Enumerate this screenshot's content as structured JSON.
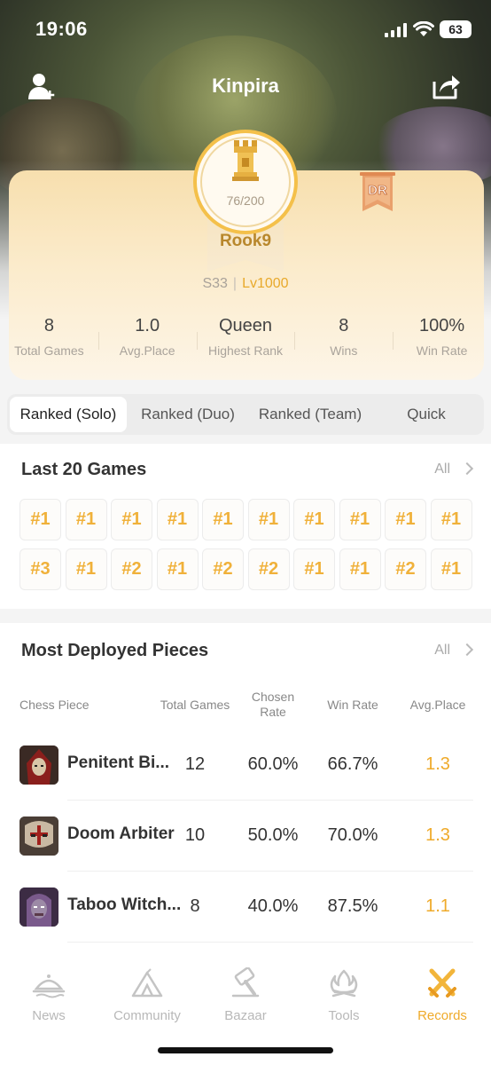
{
  "status_bar": {
    "time": "19:06",
    "battery": "63"
  },
  "header": {
    "title": "Kinpira"
  },
  "profile": {
    "rank_progress": "76/200",
    "rank_name": "Rook9",
    "season": "S33",
    "level": "Lv1000",
    "badge": "DR"
  },
  "stats": [
    {
      "value": "8",
      "label": "Total Games"
    },
    {
      "value": "1.0",
      "label": "Avg.Place"
    },
    {
      "value": "Queen",
      "label": "Highest Rank"
    },
    {
      "value": "8",
      "label": "Wins"
    },
    {
      "value": "100%",
      "label": "Win Rate"
    }
  ],
  "tabs": [
    "Ranked (Solo)",
    "Ranked (Duo)",
    "Ranked (Team)",
    "Quick"
  ],
  "last_games": {
    "title": "Last 20 Games",
    "all": "All",
    "results": [
      "#1",
      "#1",
      "#1",
      "#1",
      "#1",
      "#1",
      "#1",
      "#1",
      "#1",
      "#1",
      "#3",
      "#1",
      "#2",
      "#1",
      "#2",
      "#2",
      "#1",
      "#1",
      "#2",
      "#1"
    ]
  },
  "pieces": {
    "title": "Most Deployed Pieces",
    "all": "All",
    "columns": [
      "Chess Piece",
      "Total Games",
      "Chosen\nRate",
      "Win Rate",
      "Avg.Place"
    ],
    "rows": [
      {
        "name": "Penitent Bi...",
        "games": "12",
        "chosen": "60.0%",
        "win": "66.7%",
        "avg": "1.3"
      },
      {
        "name": "Doom Arbiter",
        "games": "10",
        "chosen": "50.0%",
        "win": "70.0%",
        "avg": "1.3"
      },
      {
        "name": "Taboo Witch...",
        "games": "8",
        "chosen": "40.0%",
        "win": "87.5%",
        "avg": "1.1"
      }
    ]
  },
  "bottom_nav": [
    "News",
    "Community",
    "Bazaar",
    "Tools",
    "Records"
  ],
  "colors": {
    "accent": "#efaa2a",
    "gold_text": "#b8872c"
  }
}
